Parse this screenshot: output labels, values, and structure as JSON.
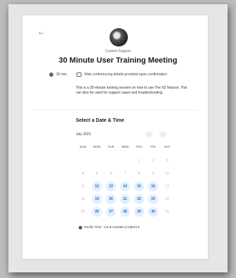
{
  "header": {
    "org_name": "Custom Support",
    "title": "30 Minute User Training Meeting",
    "duration": "30 min",
    "conferencing": "Web conferencing details provided upon confirmation",
    "description": "This is a 30-minute training session on how to use The N2 Neuron. This can also be used for support cases and troubleshooting."
  },
  "calendar": {
    "heading": "Select a Date & Time",
    "month_label": "July 2021",
    "prev_glyph": "‹",
    "next_glyph": "›",
    "weekdays": [
      "SUN",
      "MON",
      "TUE",
      "WED",
      "THU",
      "FRI",
      "SAT"
    ],
    "weeks": [
      [
        "",
        "",
        "",
        "",
        "1",
        "2",
        "3"
      ],
      [
        "4",
        "5",
        "6",
        "7",
        "8",
        "9",
        "10"
      ],
      [
        "11",
        "12",
        "13",
        "14",
        "15",
        "16",
        "17"
      ],
      [
        "18",
        "19",
        "20",
        "21",
        "22",
        "23",
        "24"
      ],
      [
        "25",
        "26",
        "27",
        "28",
        "29",
        "30",
        "31"
      ]
    ],
    "available_days": [
      "12",
      "13",
      "14",
      "15",
      "16",
      "19",
      "20",
      "21",
      "22",
      "23",
      "26",
      "27",
      "28",
      "29",
      "30"
    ]
  },
  "timezone": {
    "label": "Pacific Time - US & Canada (2:18pm) ▾"
  },
  "icons": {
    "back": "back-arrow-icon",
    "clock": "clock-icon",
    "camera": "video-camera-icon",
    "globe": "globe-icon"
  },
  "colors": {
    "accent": "#1a73e8",
    "available_bg": "#e3efff",
    "available_text": "#1a66d6"
  }
}
